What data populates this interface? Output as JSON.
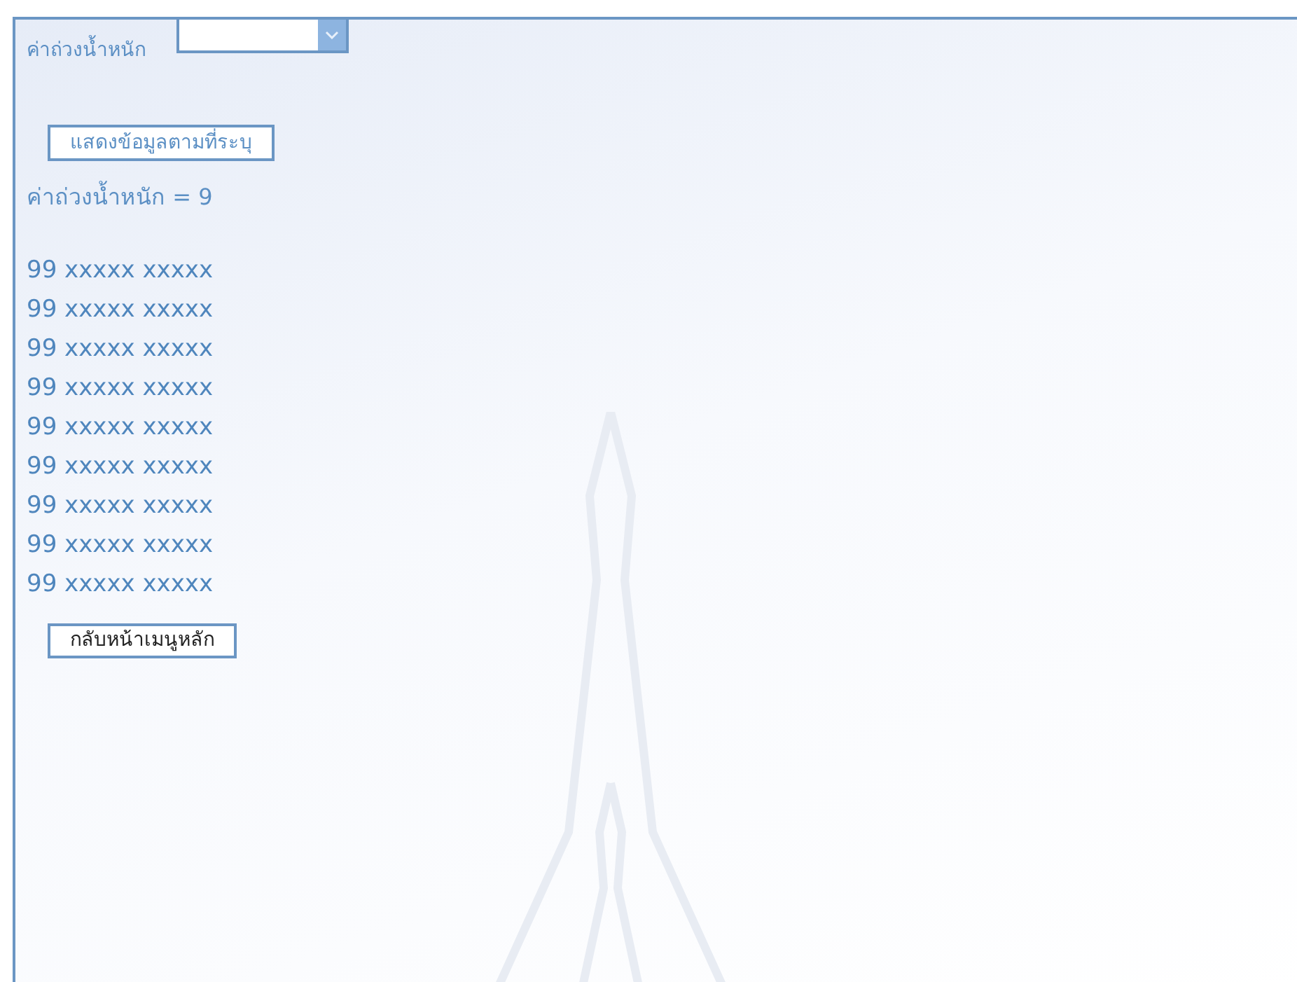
{
  "filter": {
    "label": "ค่าถ่วงน้ำหนัก"
  },
  "show_button": {
    "label": "แสดงข้อมูลตามที่ระบุ"
  },
  "result_heading": "ค่าถ่วงน้ำหนัก = 9",
  "results": [
    "99 xxxxx xxxxx",
    "99 xxxxx xxxxx",
    "99 xxxxx xxxxx",
    "99 xxxxx xxxxx",
    "99 xxxxx xxxxx",
    "99 xxxxx xxxxx",
    "99 xxxxx xxxxx",
    "99 xxxxx xxxxx",
    "99 xxxxx xxxxx"
  ],
  "back_button": {
    "label": "กลับหน้าเมนูหลัก"
  }
}
